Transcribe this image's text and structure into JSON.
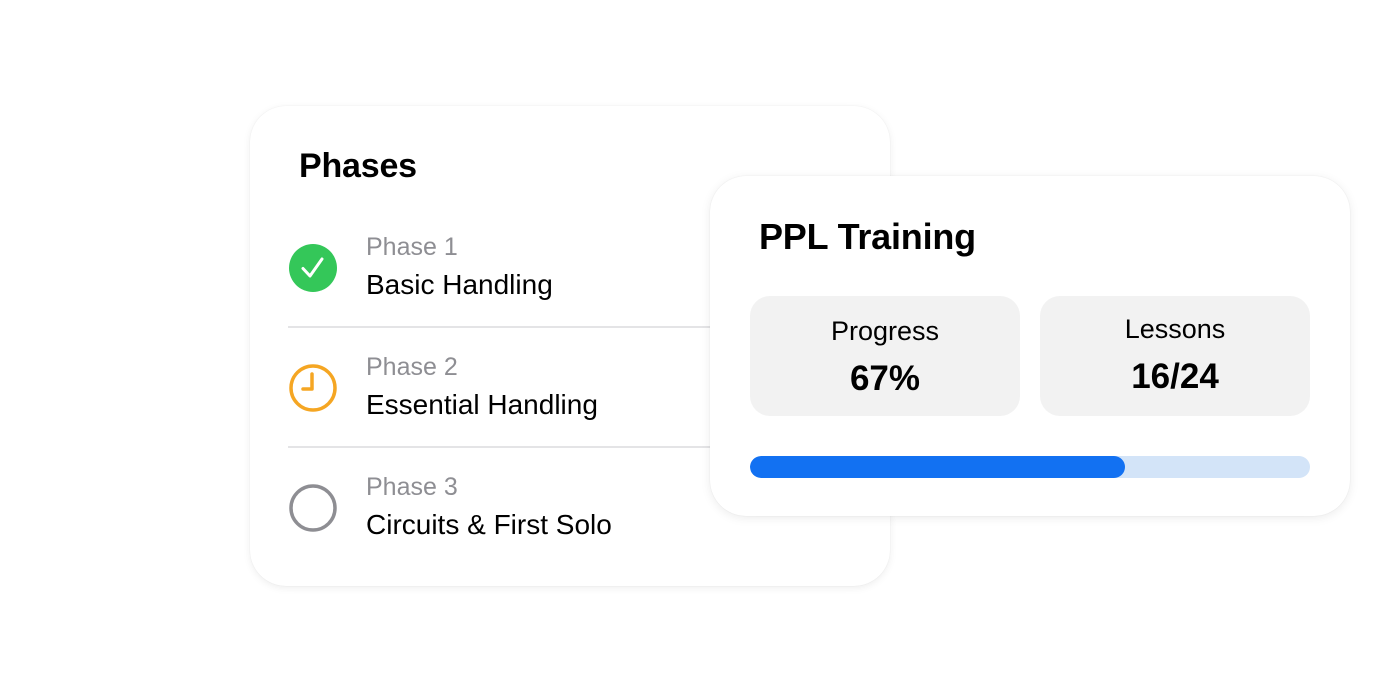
{
  "phases_card": {
    "title": "Phases",
    "items": [
      {
        "number": "Phase 1",
        "name": "Basic Handling",
        "status": "completed",
        "icon": "checkmark-circle-icon",
        "color": "#34c759"
      },
      {
        "number": "Phase 2",
        "name": "Essential Handling",
        "status": "in-progress",
        "icon": "clock-icon",
        "color": "#f5a623"
      },
      {
        "number": "Phase 3",
        "name": "Circuits & First Solo",
        "status": "not-started",
        "icon": "empty-circle-icon",
        "color": "#8e8e93"
      }
    ]
  },
  "training_card": {
    "title": "PPL Training",
    "progress_label": "Progress",
    "progress_value": "67%",
    "lessons_label": "Lessons",
    "lessons_value": "16/24",
    "progress_fraction": 0.67,
    "bar_color": "#1271f2",
    "track_color": "#d3e4f8"
  }
}
